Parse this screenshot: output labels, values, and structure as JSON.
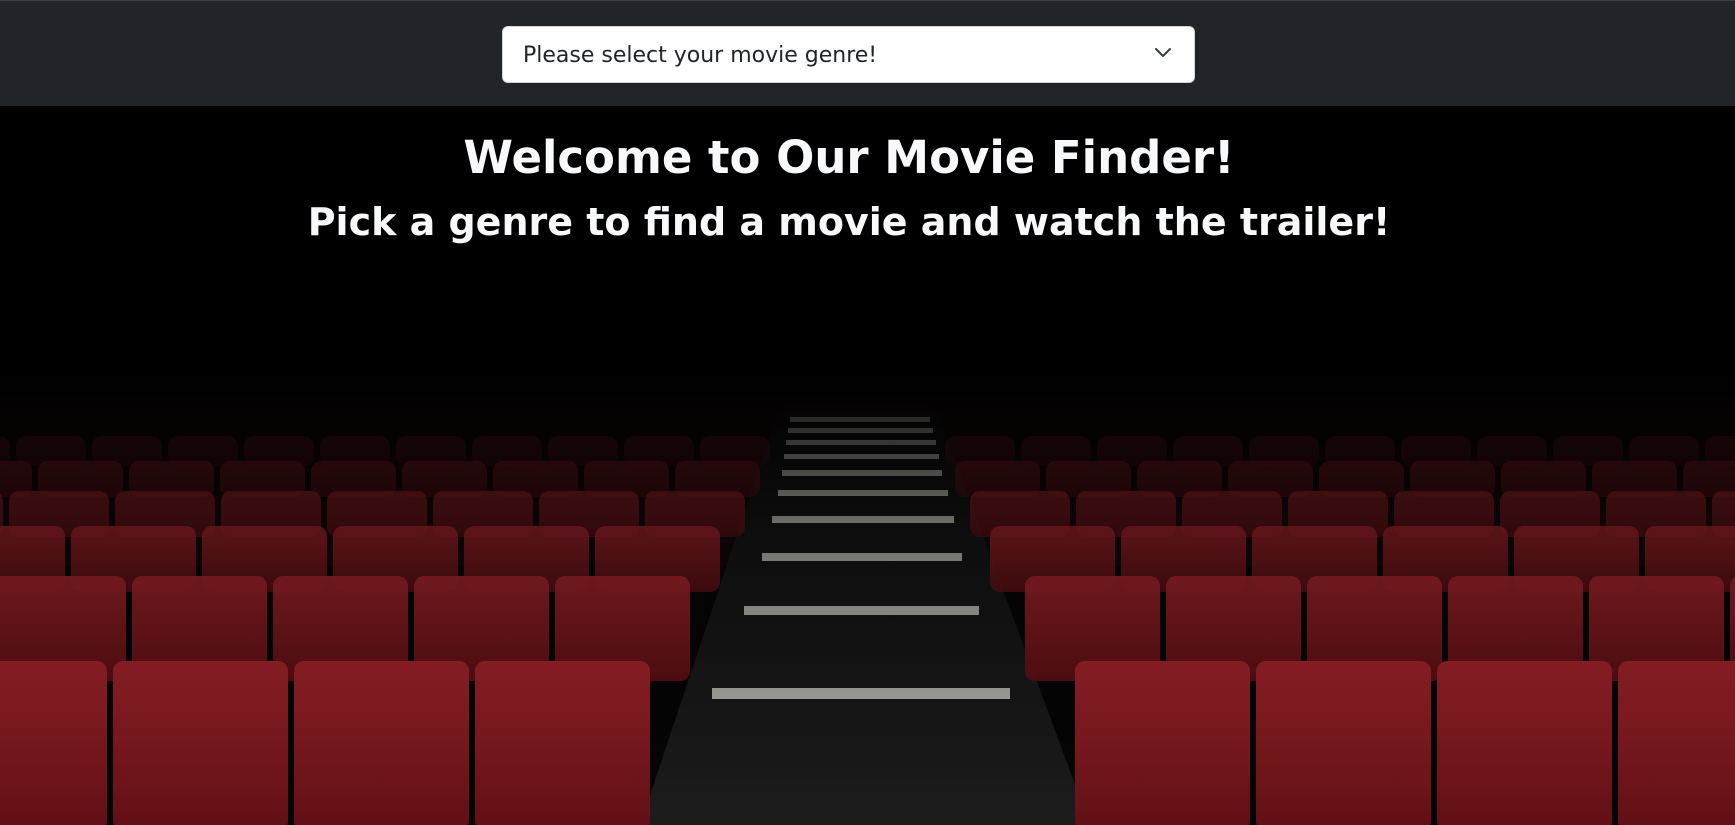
{
  "navbar": {
    "genre_select": {
      "selected": "Please select your movie genre!",
      "icon": "chevron-down-icon"
    }
  },
  "hero": {
    "title": "Welcome to Our Movie Finder!",
    "subtitle": "Pick a genre to find a movie and watch the trailer!",
    "background_image": "cinema-seats-image"
  },
  "colors": {
    "navbar_bg": "#212529",
    "text_light": "#f8f9fa",
    "seat_red": "#8b1a1f"
  }
}
